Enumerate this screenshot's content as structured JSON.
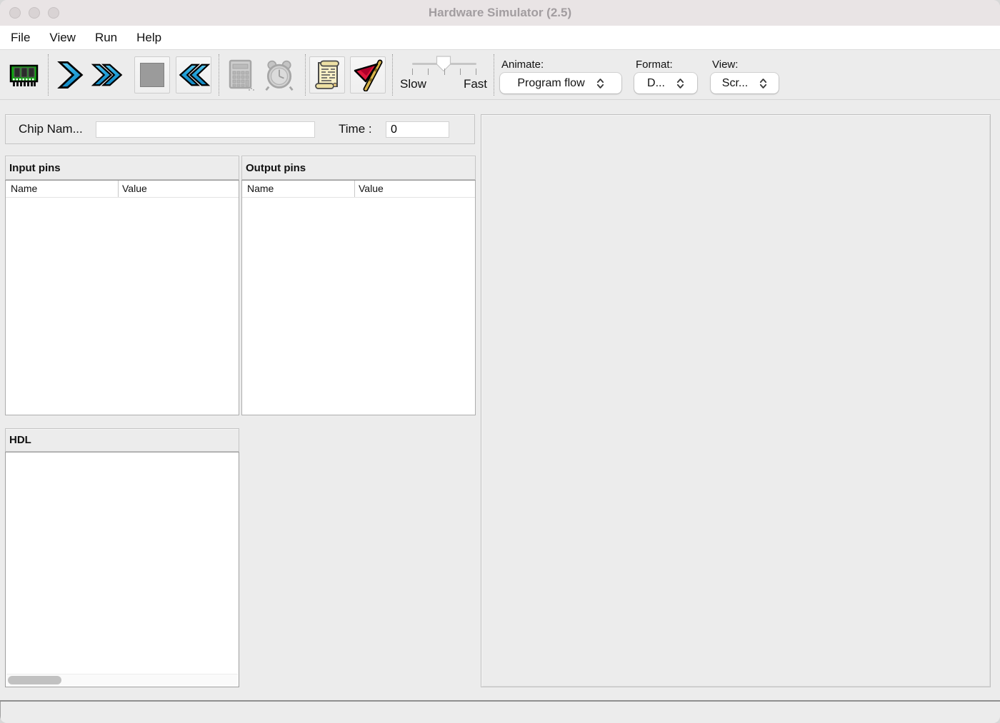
{
  "window": {
    "title": "Hardware Simulator (2.5)"
  },
  "menu": {
    "items": [
      "File",
      "View",
      "Run",
      "Help"
    ]
  },
  "toolbar": {
    "slider": {
      "left_label": "Slow",
      "right_label": "Fast"
    },
    "animate": {
      "label": "Animate:",
      "value": "Program flow"
    },
    "format": {
      "label": "Format:",
      "value": "D..."
    },
    "view": {
      "label": "View:",
      "value": "Scr..."
    }
  },
  "chip_bar": {
    "chip_name_label": "Chip Nam...",
    "chip_name_value": "",
    "time_label": "Time :",
    "time_value": "0"
  },
  "input_pins": {
    "title": "Input pins",
    "columns": [
      "Name",
      "Value"
    ],
    "rows": []
  },
  "output_pins": {
    "title": "Output pins",
    "columns": [
      "Name",
      "Value"
    ],
    "rows": []
  },
  "hdl": {
    "title": "HDL",
    "content": ""
  },
  "icons": {
    "load_chip": "memory-chip-icon",
    "step": "chevron-right-icon",
    "run": "double-chevron-right-icon",
    "stop": "stop-square-icon",
    "reset": "double-chevron-left-icon",
    "eval": "calculator-icon",
    "clock": "alarm-clock-icon",
    "script": "scroll-icon",
    "breakpoint": "flag-icon"
  },
  "colors": {
    "chevron_blue": "#25A9E0",
    "chip_green": "#12A012",
    "flag_red": "#E0173C",
    "pole_gold": "#D8B44A",
    "titlebar": "#e9e4e5",
    "panel_bg": "#ececec"
  }
}
